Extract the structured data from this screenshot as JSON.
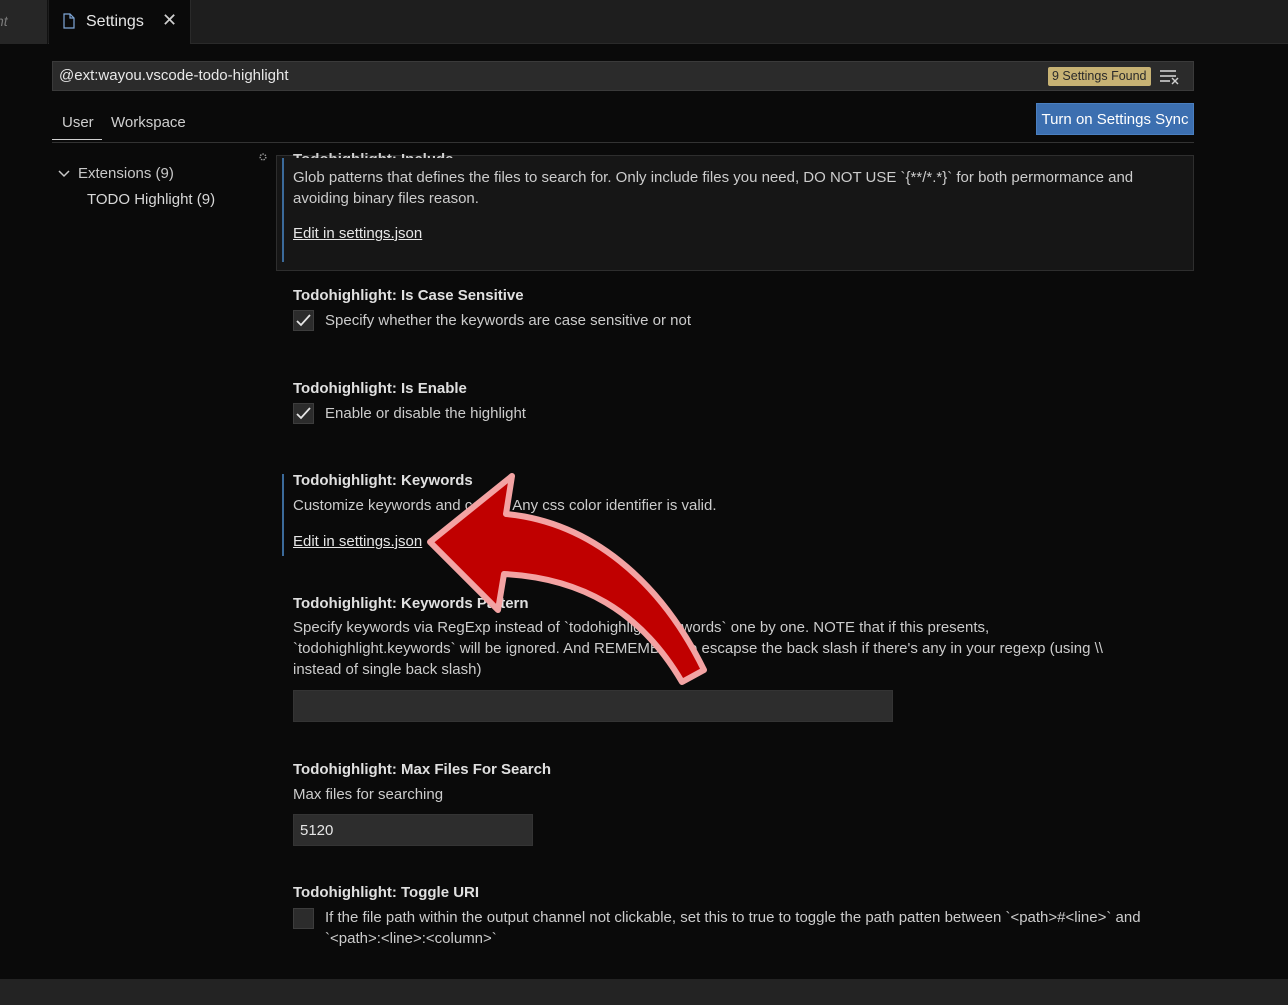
{
  "tabs": {
    "prev_tab_fragment": "ht",
    "active_tab_label": "Settings",
    "close_glyph": "✕"
  },
  "search": {
    "value": "@ext:wayou.vscode-todo-highlight",
    "found_badge": "9 Settings Found"
  },
  "scopes": {
    "user": "User",
    "workspace": "Workspace"
  },
  "sync_button": "Turn on Settings Sync",
  "toc": {
    "extensions": "Extensions (9)",
    "todo_highlight": "TODO Highlight (9)"
  },
  "settings": {
    "include": {
      "title_cut": "Todohighlight: Include",
      "desc": "Glob patterns that defines the files to search for. Only include files you need, DO NOT USE `{**/*.*}` for both permormance and avoiding binary files reason.",
      "link": "Edit in settings.json"
    },
    "case_sensitive": {
      "title": "Todohighlight: Is Case Sensitive",
      "desc": "Specify whether the keywords are case sensitive or not",
      "checked": true
    },
    "enable": {
      "title": "Todohighlight: Is Enable",
      "desc": "Enable or disable the highlight",
      "checked": true
    },
    "keywords": {
      "title": "Todohighlight: Keywords",
      "desc": "Customize keywords and colors. Any css color identifier is valid.",
      "link": "Edit in settings.json"
    },
    "keywords_pattern": {
      "title": "Todohighlight: Keywords Pattern",
      "desc": "Specify keywords via RegExp instead of `todohighlight.keywords` one by one. NOTE that if this presents, `todohighlight.keywords` will be ignored. And REMEMBER to escapse the back slash if there's any in your regexp (using \\\\ instead of single back slash)",
      "value": ""
    },
    "max_files": {
      "title": "Todohighlight: Max Files For Search",
      "desc": "Max files for searching",
      "value": "5120"
    },
    "toggle_uri": {
      "title": "Todohighlight: Toggle URI",
      "desc": "If the file path within the output channel not clickable, set this to true to toggle the path patten between `<path>#<line>` and `<path>:<line>:<column>`",
      "checked": false
    }
  },
  "colors": {
    "accent_blue": "#3c6fb0",
    "badge": "#c7b274",
    "arrow_fill": "#c00000",
    "arrow_outline": "#f3a3a3"
  },
  "icons": {
    "tab": "file-icon",
    "clear": "clear-filter-icon",
    "toc": "chevron-down-icon",
    "annotation": "curved-arrow-icon"
  }
}
